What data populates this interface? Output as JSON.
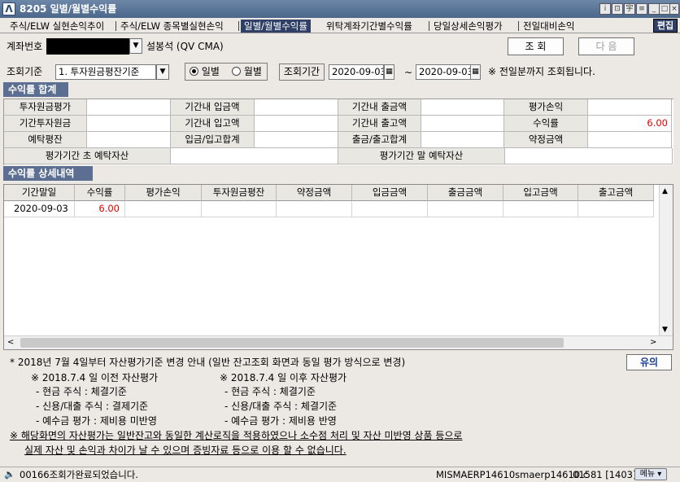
{
  "window": {
    "screen_no": "8205",
    "title": "일별/월별수익률",
    "logo_char": "Λ",
    "controls": [
      "i",
      "⊡",
      "宇",
      "≡",
      "_",
      "□",
      "×"
    ]
  },
  "tabs": [
    {
      "label": "주식/ELW 실현손익추이",
      "active": false
    },
    {
      "label": "주식/ELW 종목별실현손익",
      "active": false
    },
    {
      "label": "일별/월별수익률",
      "active": true
    },
    {
      "label": "위탁계좌기간별수익률",
      "active": false
    },
    {
      "label": "당일상세손익평가",
      "active": false
    },
    {
      "label": "전일대비손익",
      "active": false
    }
  ],
  "edit_label": "편집",
  "account": {
    "label": "계좌번호",
    "name": "설봉석 (QV CMA)",
    "query_btn": "조 회",
    "next_btn": "다 음"
  },
  "criteria": {
    "label": "조회기준",
    "selected": "1. 투자원금평잔기준",
    "radio_daily": "일별",
    "radio_monthly": "월별",
    "period_label": "조회기간",
    "date_from": "2020-09-03",
    "date_sep": "~",
    "date_to": "2020-09-03",
    "note": "※ 전일분까지 조회됩니다."
  },
  "summary": {
    "title": "수익률 합계",
    "rows": [
      [
        {
          "h": "투자원금평가"
        },
        {
          "v": "",
          "masked": true
        },
        {
          "h": "기간내 입금액"
        },
        {
          "v": ""
        },
        {
          "h": "기간내 출금액"
        },
        {
          "v": ""
        },
        {
          "h": "평가손익"
        },
        {
          "v": ""
        }
      ],
      [
        {
          "h": "기간투자원금"
        },
        {
          "v": "",
          "masked": true
        },
        {
          "h": "기간내 입고액"
        },
        {
          "v": ""
        },
        {
          "h": "기간내 출고액"
        },
        {
          "v": ""
        },
        {
          "h": "수익률"
        },
        {
          "v": "6.00",
          "red": true
        }
      ],
      [
        {
          "h": "예탁평잔"
        },
        {
          "v": "",
          "masked": true
        },
        {
          "h": "입금/입고합계"
        },
        {
          "v": ""
        },
        {
          "h": "출금/출고합계"
        },
        {
          "v": ""
        },
        {
          "h": "약정금액"
        },
        {
          "v": ""
        }
      ]
    ],
    "period_start_label": "평가기간 초 예탁자산",
    "period_end_label": "평가기간 말 예탁자산"
  },
  "detail": {
    "title": "수익률 상세내역",
    "columns": [
      "기간말일",
      "수익률",
      "평가손익",
      "투자원금평잔",
      "약정금액",
      "입금금액",
      "출금금액",
      "입고금액",
      "출고금액"
    ],
    "rows": [
      [
        "2020-09-03",
        "6.00",
        "",
        "",
        "",
        "",
        "",
        "",
        ""
      ]
    ]
  },
  "notes": {
    "headline": "* 2018년 7월 4일부터 자산평가기준 변경 안내 (일반 잔고조회 화면과 동일 평가 방식으로 변경)",
    "before_title": "※ 2018.7.4 일 이전 자산평가",
    "after_title": "※ 2018.7.4 일 이후 자산평가",
    "before_items": [
      "- 현금 주식 : 체결기준",
      "- 신용/대출 주식 : 결제기준",
      "- 예수금 평가 : 제비용 미반영"
    ],
    "after_items": [
      "- 현금 주식 : 체결기준",
      "- 신용/대출 주식 : 체결기준",
      "- 예수금 평가 : 제비용 반영"
    ],
    "warning_line1": "※ 해당화면의 자산평가는 일반잔고와 동일한 계산로직을 적용하였으나 소수점 처리 및 자산 미반영 상품 등으로",
    "warning_line2": "실제 자산 및 손익과 차이가 날 수 있으며 증빙자료 등으로 이용 할 수 없습니다.",
    "notice_btn": "유의"
  },
  "status": {
    "message": "00166조회가완료되었습니다.",
    "program": "MISMAERP14610smaerp14610.c",
    "code": "01581 [1403]",
    "menu_btn": "메뉴 ▾"
  }
}
